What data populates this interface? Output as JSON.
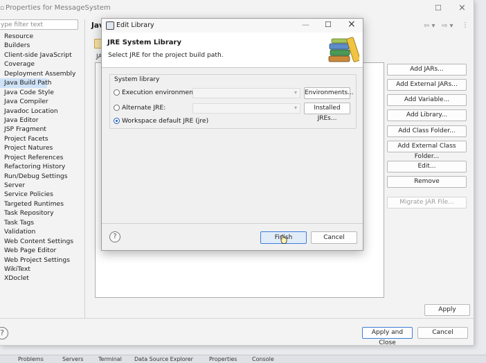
{
  "properties_window": {
    "title": "Properties for MessageSystem",
    "filter_placeholder": "ype filter text",
    "nav_items": [
      "Resource",
      "Builders",
      "Client-side JavaScript",
      "Coverage",
      "Deployment Assembly",
      "Java Build Path",
      "Java Code Style",
      "Java Compiler",
      "Javadoc Location",
      "Java Editor",
      "JSP Fragment",
      "Project Facets",
      "Project Natures",
      "Project References",
      "Refactoring History",
      "Run/Debug Settings",
      "Server",
      "Service Policies",
      "Targeted Runtimes",
      "Task Repository",
      "Task Tags",
      "Validation",
      "Web Content Settings",
      "Web Page Editor",
      "Web Project Settings",
      "WikiText",
      "XDoclet"
    ],
    "selected_nav": "Java Build Path",
    "right_title": "Jav",
    "tab_label": "JA",
    "side_buttons": {
      "add_jars": "Add JARs...",
      "add_external_jars": "Add External JARs...",
      "add_variable": "Add Variable...",
      "add_library": "Add Library...",
      "add_class_folder": "Add Class Folder...",
      "add_external_class_folder": "Add External Class Folder...",
      "edit": "Edit...",
      "remove": "Remove",
      "migrate_jar": "Migrate JAR File..."
    },
    "apply": "Apply",
    "apply_and_close": "Apply and Close",
    "cancel": "Cancel"
  },
  "dialog": {
    "title": "Edit Library",
    "heading": "JRE System Library",
    "subheading": "Select JRE for the project build path.",
    "group_label": "System library",
    "options": {
      "execution_environment": "Execution environment:",
      "alternate_jre": "Alternate JRE:",
      "workspace_default": "Workspace default JRE (jre)"
    },
    "environments_button": "Environments...",
    "installed_jres_button": "Installed JREs...",
    "finish": "Finish",
    "cancel": "Cancel",
    "selected_option": "workspace_default"
  },
  "bottom_tabs": [
    "Problems",
    "Servers",
    "Terminal",
    "Data Source Explorer",
    "Properties",
    "Console"
  ],
  "colors": {
    "selection": "#cfe3f8",
    "accent": "#1f5fbf"
  }
}
